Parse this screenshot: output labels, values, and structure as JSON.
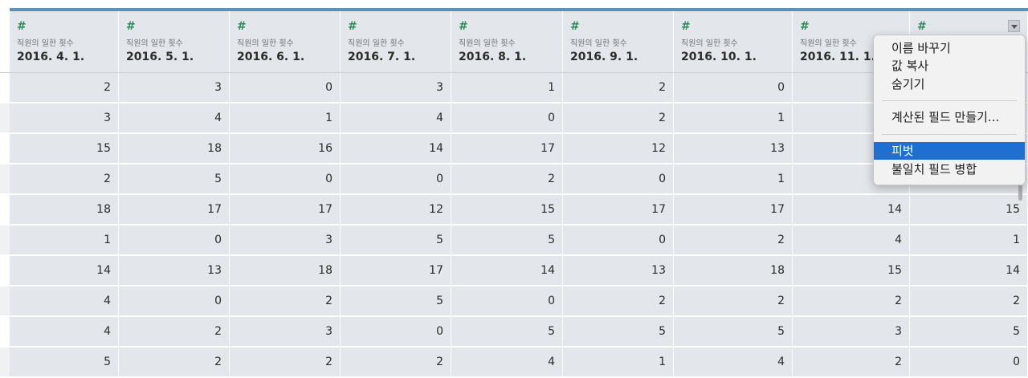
{
  "columns": [
    {
      "sub": "직원의 일한 횟수",
      "title": "2016. 4. 1."
    },
    {
      "sub": "직원의 일한 횟수",
      "title": "2016. 5. 1."
    },
    {
      "sub": "직원의 일한 횟수",
      "title": "2016. 6. 1."
    },
    {
      "sub": "직원의 일한 횟수",
      "title": "2016. 7. 1."
    },
    {
      "sub": "직원의 일한 횟수",
      "title": "2016. 8. 1."
    },
    {
      "sub": "직원의 일한 횟수",
      "title": "2016. 9. 1."
    },
    {
      "sub": "직원의 일한 횟수",
      "title": "2016. 10. 1."
    },
    {
      "sub": "직원의 일한 횟수",
      "title": "2016. 11. 1."
    },
    {
      "sub": "",
      "title": ""
    }
  ],
  "rows": [
    [
      "2",
      "3",
      "0",
      "3",
      "1",
      "2",
      "0",
      "",
      ""
    ],
    [
      "3",
      "4",
      "1",
      "4",
      "0",
      "2",
      "1",
      "",
      ""
    ],
    [
      "15",
      "18",
      "16",
      "14",
      "17",
      "12",
      "13",
      "",
      ""
    ],
    [
      "2",
      "5",
      "0",
      "0",
      "2",
      "0",
      "1",
      "",
      ""
    ],
    [
      "18",
      "17",
      "17",
      "12",
      "15",
      "17",
      "17",
      "14",
      "15"
    ],
    [
      "1",
      "0",
      "3",
      "5",
      "5",
      "0",
      "2",
      "4",
      "1"
    ],
    [
      "14",
      "13",
      "18",
      "17",
      "14",
      "13",
      "18",
      "15",
      "14"
    ],
    [
      "4",
      "0",
      "2",
      "5",
      "0",
      "2",
      "2",
      "2",
      "2"
    ],
    [
      "4",
      "2",
      "3",
      "0",
      "5",
      "5",
      "5",
      "3",
      "5"
    ],
    [
      "5",
      "2",
      "2",
      "2",
      "4",
      "1",
      "4",
      "2",
      "0"
    ]
  ],
  "menu": {
    "items": [
      "이름 바꾸기",
      "값 복사",
      "숨기기",
      "계산된 필드 만들기...",
      "피벗",
      "불일치 필드 병합"
    ],
    "highlighted": "피벗"
  },
  "icons": {
    "type_icon": "number-type-icon",
    "dropdown": "chevron-down-icon"
  },
  "colors": {
    "accent": "#5f91b5",
    "highlight": "#1f6fd1",
    "type_icon": "#2e8b57"
  }
}
